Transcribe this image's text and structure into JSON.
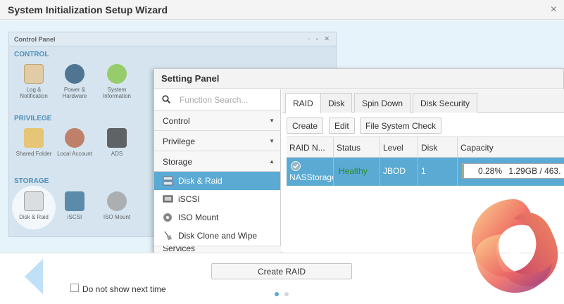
{
  "wizard": {
    "title": "System Initialization Setup Wizard",
    "close_glyph": "×"
  },
  "control_panel": {
    "title": "Control Panel",
    "sections": [
      {
        "label": "CONTROL"
      },
      {
        "label": "PRIVILEGE"
      },
      {
        "label": "STORAGE"
      }
    ],
    "control_icons": [
      {
        "label": "Log & Notification",
        "icon": "log-icon"
      },
      {
        "label": "Power & Hardware",
        "icon": "power-icon"
      },
      {
        "label": "System Information",
        "icon": "info-icon"
      }
    ],
    "privilege_icons": [
      {
        "label": "Shared Folder",
        "icon": "folder-icon"
      },
      {
        "label": "Local Account",
        "icon": "users-icon"
      },
      {
        "label": "ADS",
        "icon": "server-icon"
      }
    ],
    "storage_icons": [
      {
        "label": "Disk & Raid",
        "icon": "disk-raid-icon"
      },
      {
        "label": "iSCSI",
        "icon": "iscsi-icon"
      },
      {
        "label": "ISO Mount",
        "icon": "iso-icon"
      }
    ]
  },
  "setting_panel": {
    "title": "Setting Panel",
    "search_placeholder": "Function Search...",
    "categories": [
      {
        "label": "Control",
        "arrow": "▼"
      },
      {
        "label": "Privilege",
        "arrow": "▼"
      },
      {
        "label": "Storage",
        "arrow": "▲"
      }
    ],
    "storage_items": [
      {
        "label": "Disk & Raid",
        "icon": "disk-raid-icon",
        "active": true
      },
      {
        "label": "iSCSI",
        "icon": "iscsi-icon",
        "active": false
      },
      {
        "label": "ISO Mount",
        "icon": "iso-icon",
        "active": false
      },
      {
        "label": "Disk Clone and Wipe",
        "icon": "broom-icon",
        "active": false
      }
    ],
    "next_category": "Services",
    "tabs": [
      {
        "label": "RAID",
        "active": true
      },
      {
        "label": "Disk",
        "active": false
      },
      {
        "label": "Spin Down",
        "active": false
      },
      {
        "label": "Disk Security",
        "active": false
      }
    ],
    "toolbar": {
      "create": "Create",
      "edit": "Edit",
      "fs_check": "File System Check"
    },
    "columns": [
      "RAID N...",
      "Status",
      "Level",
      "Disk",
      "Capacity"
    ],
    "row": {
      "name": "NASStorage",
      "status": "Healthy",
      "level": "JBOD",
      "disk": "1",
      "usage_percent": "0.28%",
      "usage_fraction": 0.0028,
      "capacity": "1.29GB / 463.",
      "status_color": "#2e8b22"
    }
  },
  "footer": {
    "create_raid": "Create RAID",
    "checkbox_label": "Do not show next time",
    "page_dots": [
      {
        "active": true
      },
      {
        "active": false
      }
    ]
  },
  "colors": {
    "accent": "#5aaad4",
    "section": "#1e6ea8"
  }
}
